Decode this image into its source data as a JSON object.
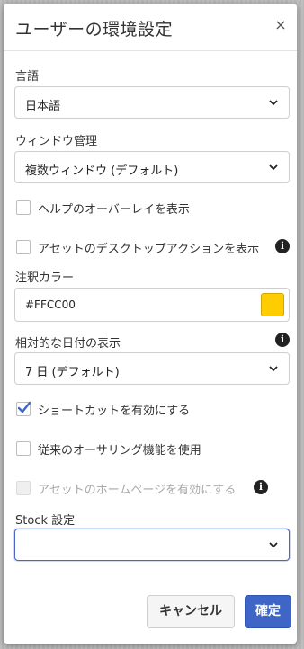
{
  "dialog": {
    "title": "ユーザーの環境設定",
    "close_label": "×"
  },
  "language": {
    "label": "言語",
    "selected": "日本語"
  },
  "window_management": {
    "label": "ウィンドウ管理",
    "selected": "複数ウィンドウ (デフォルト)"
  },
  "checkboxes": {
    "help_overlay": {
      "label": "ヘルプのオーバーレイを表示",
      "checked": false
    },
    "asset_desktop_actions": {
      "label": "アセットのデスクトップアクションを表示",
      "checked": false
    },
    "enable_shortcuts": {
      "label": "ショートカットを有効にする",
      "checked": true
    },
    "legacy_authoring": {
      "label": "従来のオーサリング機能を使用",
      "checked": false
    },
    "asset_homepage": {
      "label": "アセットのホームページを有効にする",
      "checked": false,
      "disabled": true
    }
  },
  "annotation_color": {
    "label": "注釈カラー",
    "value": "#FFCC00",
    "swatch_color": "#FFCC00"
  },
  "relative_date": {
    "label": "相対的な日付の表示",
    "selected": "7 日 (デフォルト)"
  },
  "stock": {
    "label": "Stock 設定",
    "selected": ""
  },
  "info_icon": "i",
  "footer": {
    "cancel_label": "キャンセル",
    "confirm_label": "確定"
  },
  "colors": {
    "primary": "#3F66C7",
    "checkmark": "#3F66C7"
  }
}
